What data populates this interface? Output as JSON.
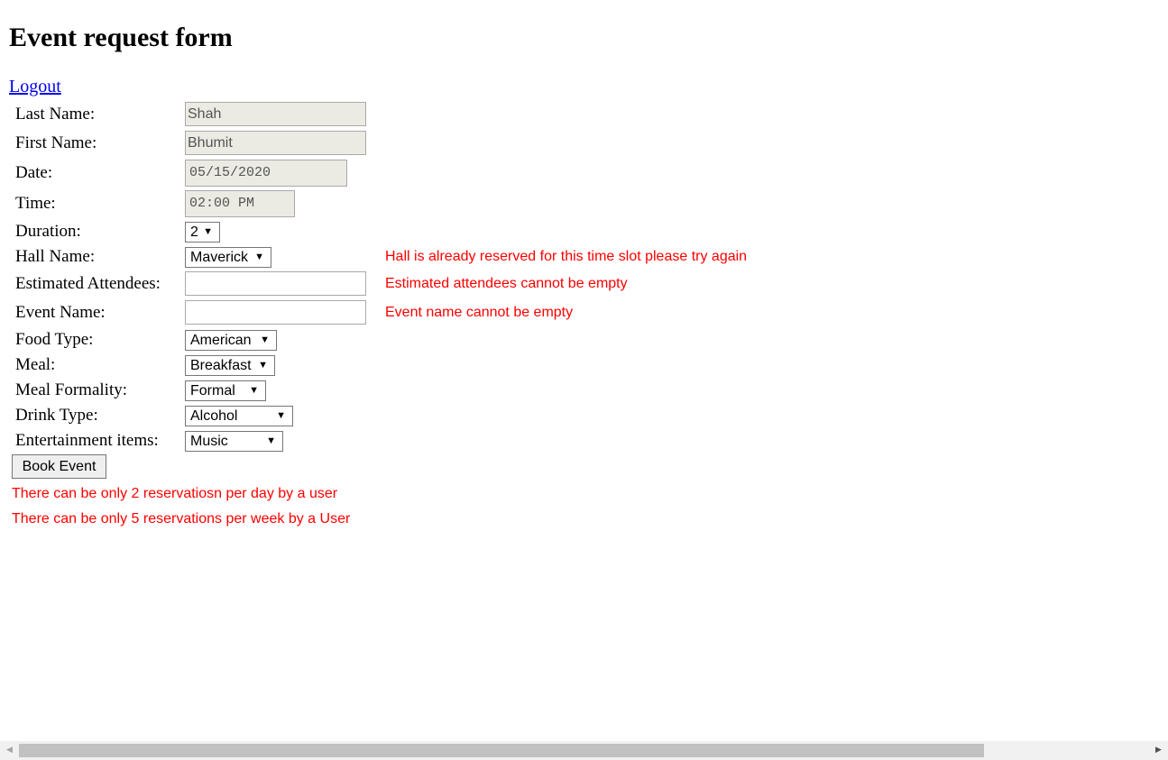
{
  "page_title": "Event request form",
  "logout_label": "Logout",
  "fields": {
    "last_name": {
      "label": "Last Name:",
      "value": "Shah"
    },
    "first_name": {
      "label": "First Name:",
      "value": "Bhumit"
    },
    "date": {
      "label": "Date:",
      "value": "05/15/2020"
    },
    "time": {
      "label": "Time:",
      "value": "02:00 PM"
    },
    "duration": {
      "label": "Duration:",
      "value": "2"
    },
    "hall_name": {
      "label": "Hall Name:",
      "value": "Maverick",
      "error": "Hall is already reserved for this time slot please try again"
    },
    "estimated_attendees": {
      "label": "Estimated Attendees:",
      "value": "",
      "error": "Estimated attendees cannot be empty"
    },
    "event_name": {
      "label": "Event Name:",
      "value": "",
      "error": "Event name cannot be empty"
    },
    "food_type": {
      "label": "Food Type:",
      "value": "American"
    },
    "meal": {
      "label": "Meal:",
      "value": "Breakfast"
    },
    "meal_formality": {
      "label": "Meal Formality:",
      "value": "Formal"
    },
    "drink_type": {
      "label": "Drink Type:",
      "value": "Alcohol"
    },
    "entertainment": {
      "label": "Entertainment items:",
      "value": "Music"
    }
  },
  "submit_label": "Book Event",
  "errors": {
    "per_day": "There can be only 2 reservatiosn per day by a user",
    "per_week": "There can be only 5 reservations per week by a User"
  },
  "colors": {
    "error": "#ff0000",
    "link": "#0000ee",
    "disabled_bg": "#ebebe4"
  },
  "icons": {
    "dropdown": "chevron-down-icon",
    "scroll_left": "arrow-left-icon",
    "scroll_right": "arrow-right-icon"
  }
}
